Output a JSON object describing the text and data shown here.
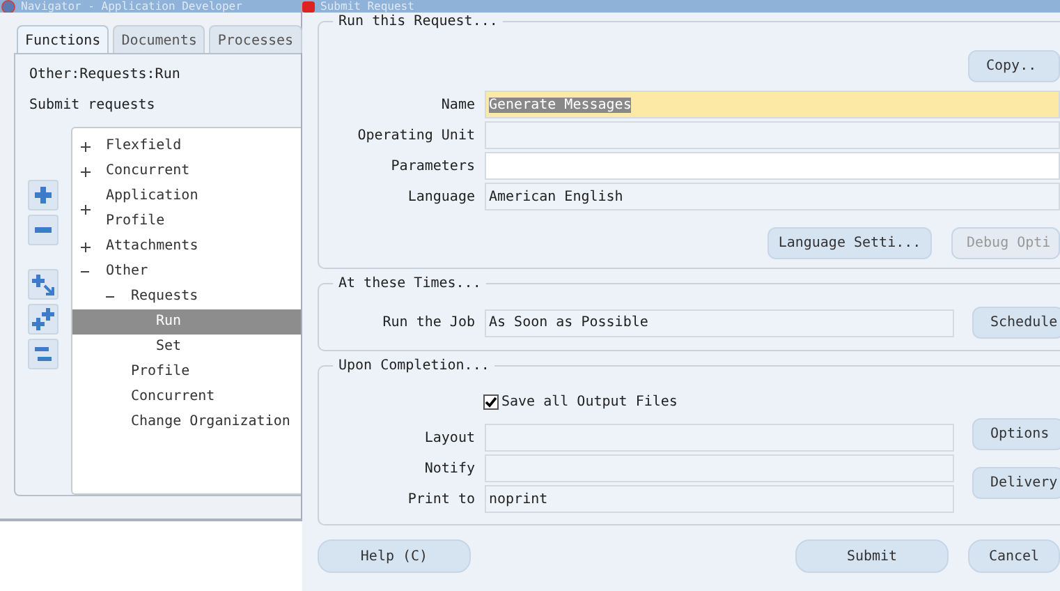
{
  "navigator": {
    "title": "Navigator - Application Developer",
    "tabs": [
      {
        "label": "Functions",
        "selected": true
      },
      {
        "label": "Documents",
        "selected": false
      },
      {
        "label": "Processes",
        "selected": false
      }
    ],
    "path": "Other:Requests:Run",
    "description": "Submit requests",
    "tree": [
      {
        "label": "Flexfield",
        "expanded": false,
        "selected": false
      },
      {
        "label": "Concurrent",
        "expanded": false,
        "selected": false
      },
      {
        "label": "Application\nProfile",
        "expanded": false,
        "selected": false
      },
      {
        "label": "Attachments",
        "expanded": false,
        "selected": false
      },
      {
        "label": "Other",
        "expanded": true,
        "selected": false,
        "children": [
          {
            "label": "Requests",
            "expanded": true,
            "selected": false,
            "children": [
              {
                "label": "Run",
                "selected": true
              },
              {
                "label": "Set",
                "selected": false
              }
            ]
          },
          {
            "label": "Profile",
            "selected": false
          },
          {
            "label": "Concurrent",
            "selected": false
          },
          {
            "label": "Change Organization",
            "selected": false
          }
        ]
      }
    ]
  },
  "submit_request": {
    "title": "Submit Request",
    "run_group": {
      "legend": "Run this Request...",
      "copy_button": "Copy..",
      "fields": [
        {
          "label": "Name",
          "value": "Generate Messages",
          "kind": "selected"
        },
        {
          "label": "Operating Unit",
          "kind": "plain"
        },
        {
          "label": "Parameters",
          "kind": "white"
        },
        {
          "label": "Language",
          "value": "American English",
          "kind": "plain"
        }
      ],
      "buttons": [
        {
          "label": "Language Setti...",
          "disabled": false
        },
        {
          "label": "Debug Opti",
          "disabled": true
        }
      ]
    },
    "times_group": {
      "legend": "At these Times...",
      "label": "Run the Job",
      "value": "As Soon as Possible",
      "button": "Schedule"
    },
    "completion_group": {
      "legend": "Upon Completion...",
      "save_output": {
        "label": "Save all Output Files",
        "checked": true
      },
      "fields": [
        {
          "label": "Layout"
        },
        {
          "label": "Notify"
        },
        {
          "label": "Print to",
          "value": "noprint"
        }
      ],
      "buttons": [
        "Options",
        "Delivery"
      ]
    },
    "footer_buttons": [
      {
        "label": "Help (C)",
        "kind": "help"
      },
      {
        "label": "Submit",
        "kind": "action"
      },
      {
        "label": "Cancel",
        "kind": "action"
      }
    ]
  }
}
